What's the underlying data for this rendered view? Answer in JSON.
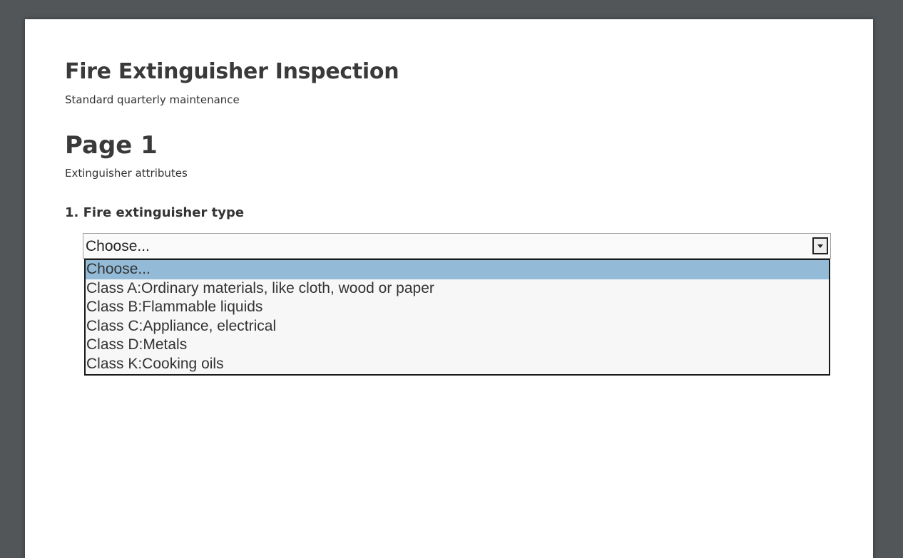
{
  "form": {
    "title": "Fire Extinguisher Inspection",
    "subtitle": "Standard quarterly maintenance"
  },
  "page": {
    "heading": "Page 1",
    "subtitle": "Extinguisher attributes"
  },
  "question": {
    "label": "1. Fire extinguisher type",
    "select": {
      "value": "Choose...",
      "options": [
        "Choose...",
        "Class A:Ordinary materials, like cloth, wood or paper",
        "Class B:Flammable liquids",
        "Class C:Appliance, electrical",
        "Class D:Metals",
        "Class K:Cooking oils"
      ],
      "highlight_color": "#93bbd8",
      "arrow_icon": "chevron-down-icon"
    }
  },
  "colors": {
    "viewer_background": "#525659",
    "page_background": "#ffffff"
  }
}
